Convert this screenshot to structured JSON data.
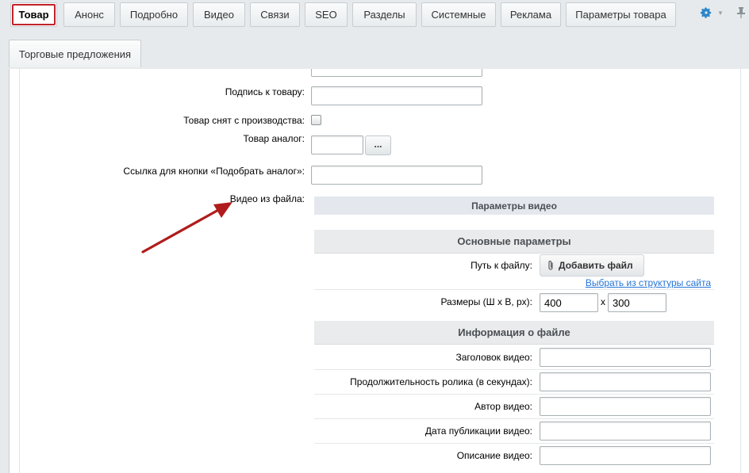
{
  "tabs": [
    {
      "label": "Товар",
      "active": true
    },
    {
      "label": "Анонс"
    },
    {
      "label": "Подробно"
    },
    {
      "label": "Видео"
    },
    {
      "label": "Связи"
    },
    {
      "label": "SEO"
    },
    {
      "label": "Разделы"
    },
    {
      "label": "Системные"
    },
    {
      "label": "Реклама"
    },
    {
      "label": "Параметры товара"
    }
  ],
  "subtabs": [
    {
      "label": "Торговые предложения"
    }
  ],
  "form": {
    "signature_label": "Подпись к товару:",
    "signature_value": "",
    "discontinued_label": "Товар снят с производства:",
    "discontinued_checked": false,
    "analog_label": "Товар аналог:",
    "analog_value": "",
    "analog_button": "...",
    "analog_link_label": "Ссылка для кнопки «Подобрать аналог»:",
    "analog_link_value": "",
    "video_label": "Видео из файла:"
  },
  "video": {
    "params_title": "Параметры видео",
    "basic_title": "Основные параметры",
    "path_label": "Путь к файлу:",
    "add_file_button": "Добавить файл",
    "structure_link": "Выбрать из структуры сайта",
    "size_label": "Размеры (Ш x В, px):",
    "width": "400",
    "height": "300",
    "size_sep": "x",
    "info_title": "Информация о файле",
    "fields": [
      {
        "label": "Заголовок видео:",
        "value": ""
      },
      {
        "label": "Продолжительность ролика (в секундах):",
        "value": ""
      },
      {
        "label": "Автор видео:",
        "value": ""
      },
      {
        "label": "Дата публикации видео:",
        "value": ""
      },
      {
        "label": "Описание видео:",
        "value": ""
      }
    ]
  },
  "colors": {
    "active_outline": "#c1232a",
    "arrow": "#b01c1c",
    "link": "#2675d7",
    "gear": "#2e86c9"
  },
  "icons": {
    "settings": "gear-icon",
    "pin": "pin-icon",
    "attach": "paperclip-icon"
  }
}
